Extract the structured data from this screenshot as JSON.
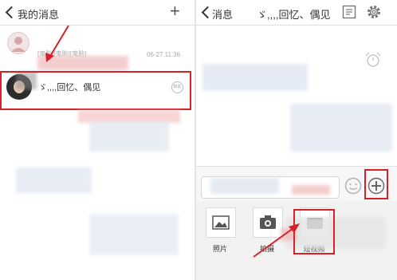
{
  "left": {
    "nav_title": "我的消息",
    "add_icon": "plus-icon",
    "sys_row": {
      "label": "[鬼脸][鬼脸][鬼脸]",
      "time": "06-27 11:36"
    },
    "chat_row": {
      "name": "ゞ,,,,回忆、偶见",
      "badge": "好友"
    }
  },
  "right": {
    "back_label": "消息",
    "chat_title": "ゞ,,,,回忆、偶见",
    "attach": {
      "photo": "照片",
      "camera": "拍摄",
      "video": "短视频"
    }
  },
  "colors": {
    "highlight": "#d6202a",
    "bubble_pink": "#f4c9c9",
    "bubble_blue": "#c9d9ee"
  }
}
